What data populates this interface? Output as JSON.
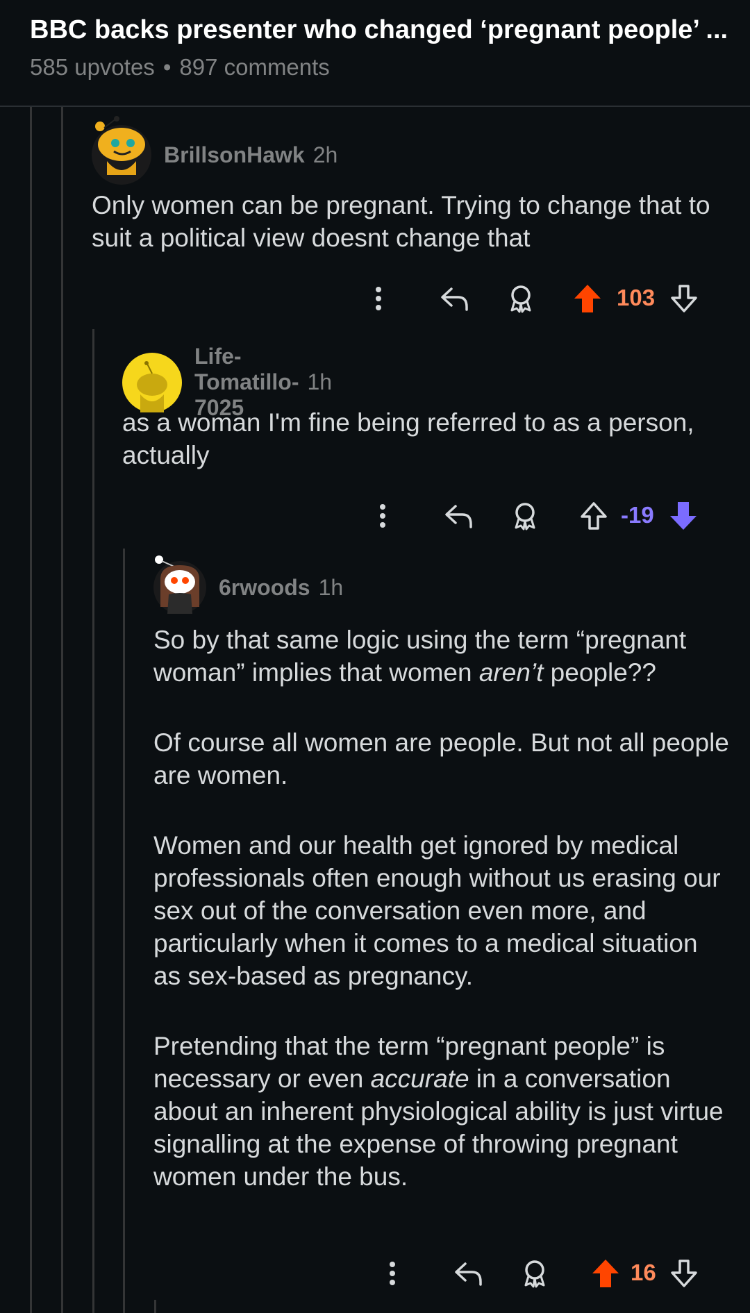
{
  "post": {
    "title": "BBC backs presenter who changed ‘pregnant people’ ...",
    "upvotes": "585 upvotes",
    "separator": "•",
    "comments": "897 comments"
  },
  "comments": [
    {
      "username": "BrillsonHawk",
      "time": "2h",
      "paragraphs": [
        "Only women can be pregnant. Trying to change that to suit a political view doesnt change that"
      ],
      "score": "103",
      "vote_state": "upvoted",
      "score_color": "#ff8a5b"
    },
    {
      "username": "Life-Tomatillo-7025",
      "time": "1h",
      "paragraphs": [
        "as a woman I'm fine being referred to as a person, actually"
      ],
      "score": "-19",
      "vote_state": "downvoted",
      "score_color": "#8a7bff"
    },
    {
      "username": "6rwoods",
      "time": "1h",
      "p1_a": "So by that same logic using the term “pregnant woman” implies that women ",
      "p1_em": "aren’t",
      "p1_b": " people??",
      "p2": "Of course all women are people. But not all people are women.",
      "p3": "Women and our health get ignored by medical professionals often enough without us erasing our sex out of the conversation even more, and particularly when it comes to a medical situation as sex-based as pregnancy.",
      "p4_a": "Pretending that the term “pregnant people” is necessary or even ",
      "p4_em": "accurate",
      "p4_b": " in a conversation about an inherent physiological ability is just virtue signalling at the expense of throwing pregnant women under the bus.",
      "score": "16",
      "vote_state": "upvoted",
      "score_color": "#ff8a5b"
    }
  ],
  "icons": {
    "more": "more-vertical-icon",
    "reply": "reply-icon",
    "award": "award-icon",
    "upvote": "upvote-icon",
    "downvote": "downvote-icon"
  },
  "colors": {
    "upvote": "#ff4500",
    "downvote": "#7b6cff",
    "upvote_score": "#ff8a5b",
    "downvote_score": "#8a7bff",
    "muted": "#818384"
  }
}
